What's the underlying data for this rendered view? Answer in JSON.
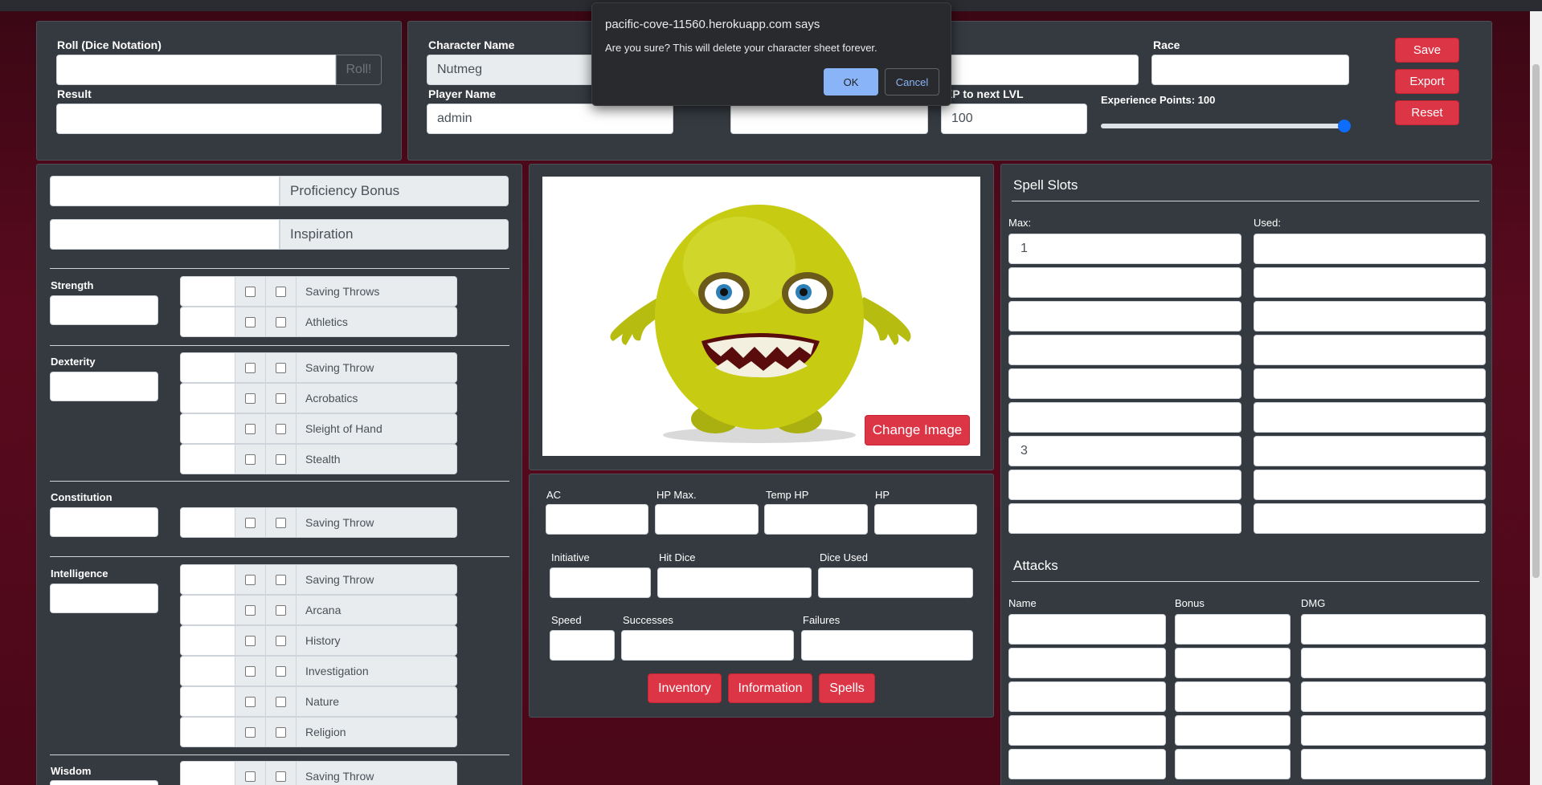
{
  "dialog": {
    "origin": "pacific-cove-11560.herokuapp.com says",
    "message": "Are you sure? This will delete your character sheet forever.",
    "ok_label": "OK",
    "cancel_label": "Cancel"
  },
  "roller": {
    "roll_label": "Roll (Dice Notation)",
    "roll_button": "Roll!",
    "result_label": "Result"
  },
  "header": {
    "character_name_label": "Character Name",
    "character_name_value": "Nutmeg",
    "player_name_label": "Player Name",
    "player_name_value": "admin",
    "race_label": "Race",
    "xp_next_label": "XP to next LVL",
    "xp_next_value": "100",
    "experience_label": "Experience Points: 100",
    "experience_value": 1.0,
    "save_label": "Save",
    "export_label": "Export",
    "reset_label": "Reset"
  },
  "abilities": {
    "proficiency_label": "Proficiency Bonus",
    "inspiration_label": "Inspiration",
    "strength": "Strength",
    "dexterity": "Dexterity",
    "constitution": "Constitution",
    "intelligence": "Intelligence",
    "wisdom": "Wisdom",
    "skills": {
      "str_save": "Saving Throws",
      "athletics": "Athletics",
      "dex_save": "Saving Throw",
      "acrobatics": "Acrobatics",
      "sleight": "Sleight of Hand",
      "stealth": "Stealth",
      "con_save": "Saving Throw",
      "int_save": "Saving Throw",
      "arcana": "Arcana",
      "history": "History",
      "investigation": "Investigation",
      "nature": "Nature",
      "religion": "Religion",
      "wis_save": "Saving Throw"
    }
  },
  "portrait": {
    "change_image_label": "Change Image"
  },
  "combat": {
    "ac": "AC",
    "hp_max": "HP Max.",
    "temp_hp": "Temp HP",
    "hp": "HP",
    "initiative": "Initiative",
    "hit_dice": "Hit Dice",
    "dice_used": "Dice Used",
    "speed": "Speed",
    "successes": "Successes",
    "failures": "Failures",
    "inventory": "Inventory",
    "information": "Information",
    "spells": "Spells"
  },
  "spell_slots": {
    "title": "Spell Slots",
    "max_label": "Max:",
    "used_label": "Used:",
    "max_values": [
      "1",
      "",
      "",
      "",
      "",
      "",
      "3",
      "",
      ""
    ]
  },
  "attacks": {
    "title": "Attacks",
    "name_label": "Name",
    "bonus_label": "Bonus",
    "dmg_label": "DMG"
  },
  "colors": {
    "accent_red": "#dc3545",
    "panel": "#343a40",
    "slider": "#0d6efd"
  }
}
